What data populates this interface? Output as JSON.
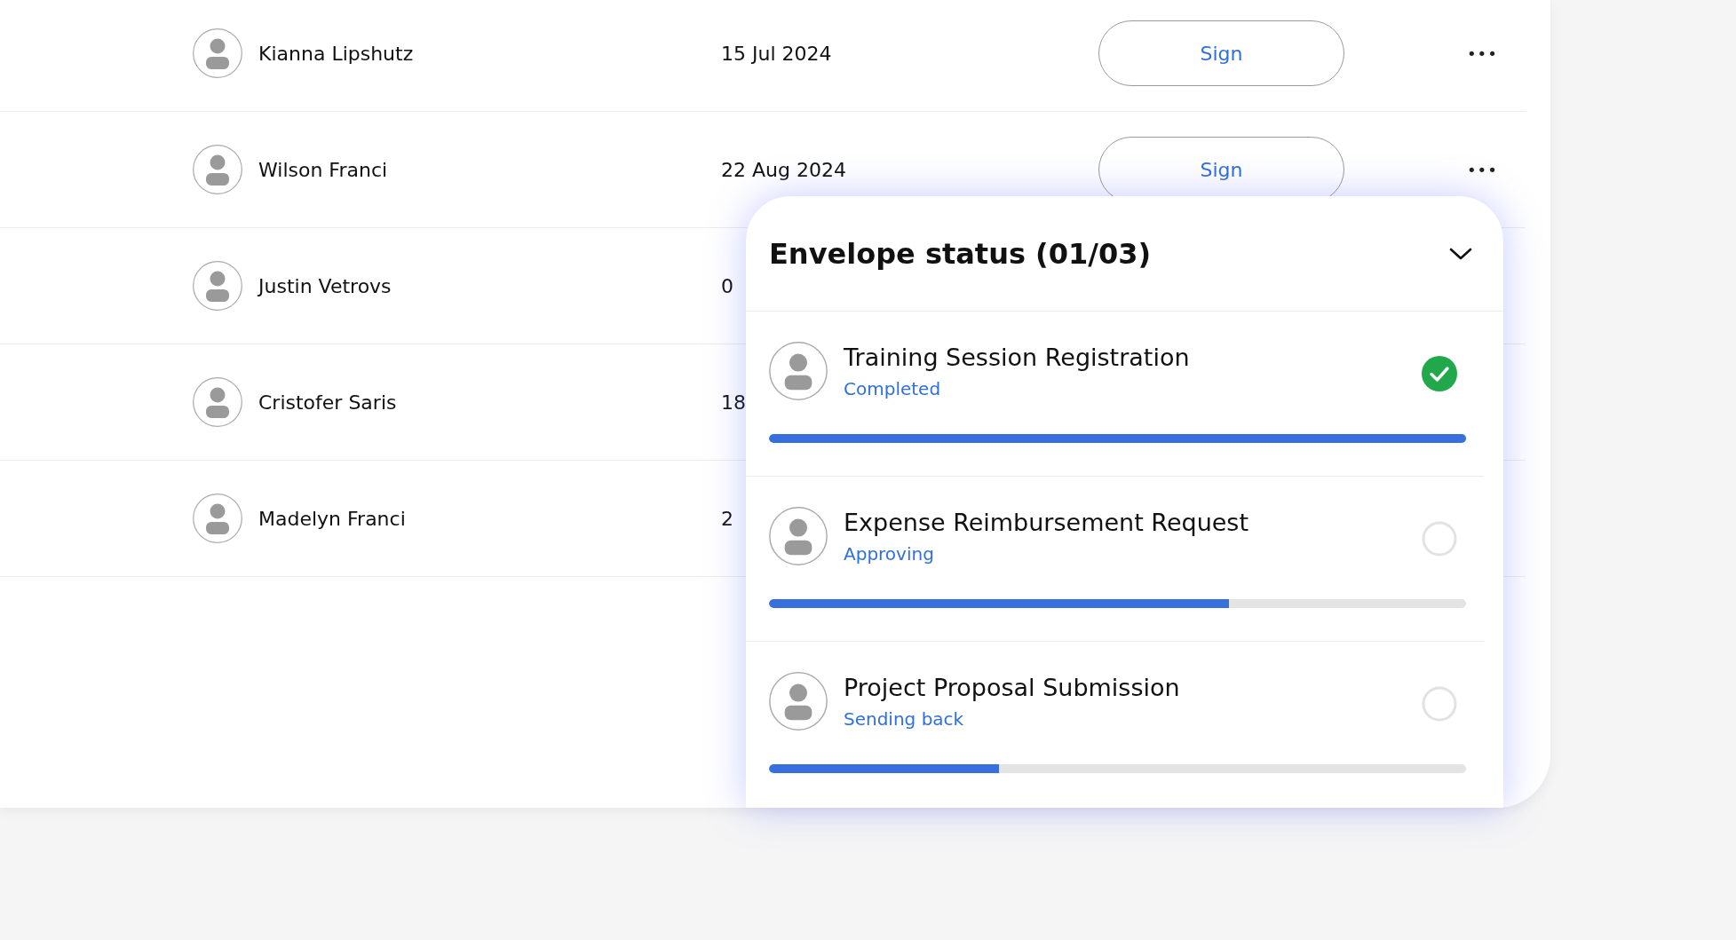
{
  "rows": [
    {
      "name": "Kianna Lipshutz",
      "date": "15 Jul 2024",
      "action": "Sign",
      "more": "•••"
    },
    {
      "name": "Wilson Franci",
      "date": "22 Aug 2024",
      "action": "Sign",
      "more": "•••"
    },
    {
      "name": "Justin Vetrovs",
      "date": "0"
    },
    {
      "name": "Cristofer Saris",
      "date": "18"
    },
    {
      "name": "Madelyn Franci",
      "date": "2"
    }
  ],
  "envelope_panel": {
    "title": "Envelope status (01/03)",
    "expanded": true,
    "items": [
      {
        "title": "Training Session Registration",
        "status": "Completed",
        "completed": true,
        "level": 1.0
      },
      {
        "title": "Expense Reimbursement Request",
        "status": "Approving",
        "completed": false,
        "level": 0.66
      },
      {
        "title": "Project Proposal Submission",
        "status": "Sending back",
        "completed": false,
        "level": 0.33
      }
    ]
  }
}
